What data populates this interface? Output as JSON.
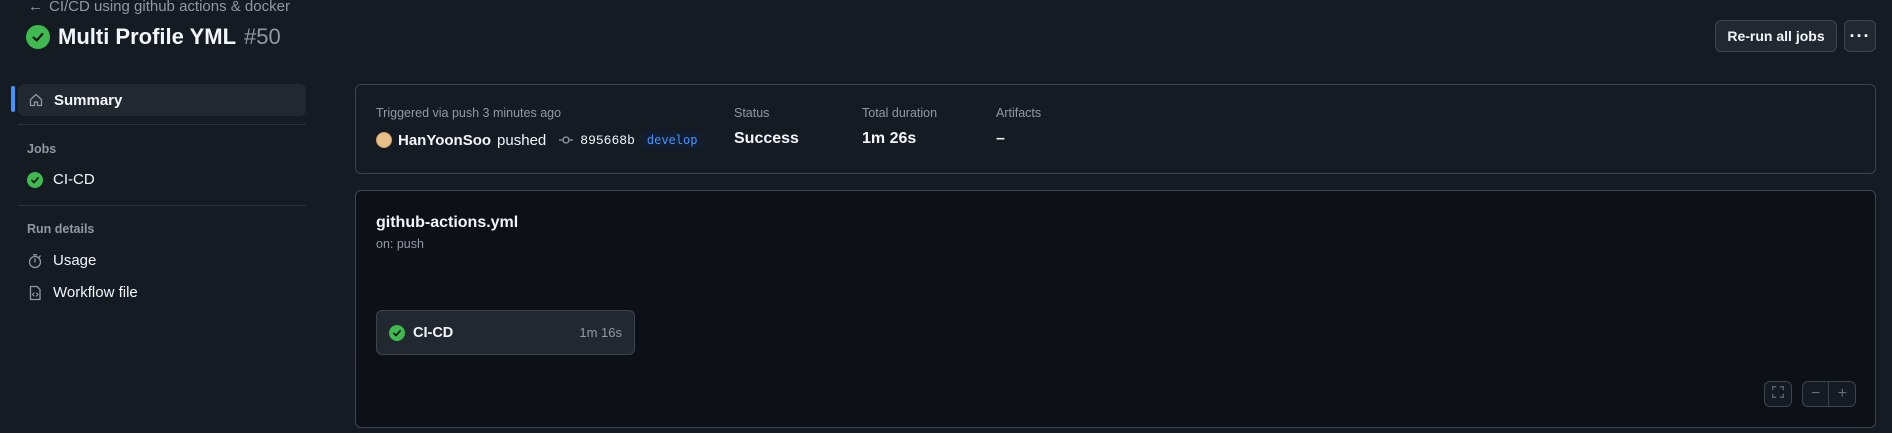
{
  "header": {
    "back_link": "CI/CD using github actions & docker",
    "title": "Multi Profile YML",
    "run_number": "#50",
    "rerun_label": "Re-run all jobs",
    "more_label": "···"
  },
  "sidebar": {
    "summary_label": "Summary",
    "jobs_heading": "Jobs",
    "jobs": [
      {
        "label": "CI-CD",
        "status": "success"
      }
    ],
    "run_details_heading": "Run details",
    "usage_label": "Usage",
    "workflow_file_label": "Workflow file"
  },
  "summary": {
    "trigger_text": "Triggered via push 3 minutes ago",
    "actor": "HanYoonSoo",
    "action": "pushed",
    "commit_sha": "895668b",
    "branch": "develop",
    "status_label": "Status",
    "status_value": "Success",
    "duration_label": "Total duration",
    "duration_value": "1m 26s",
    "artifacts_label": "Artifacts",
    "artifacts_value": "–"
  },
  "workflow": {
    "file_name": "github-actions.yml",
    "trigger": "on: push",
    "job": {
      "name": "CI-CD",
      "duration": "1m 16s"
    }
  },
  "colors": {
    "success": "#3fb950",
    "accent": "#4493f8",
    "background": "#151b23",
    "canvas": "#0d1117"
  },
  "icons": [
    "arrow-left-icon",
    "check-circle-icon",
    "home-icon",
    "stopwatch-icon",
    "file-code-icon",
    "git-commit-icon",
    "fullscreen-icon",
    "zoom-out-icon",
    "zoom-in-icon"
  ]
}
